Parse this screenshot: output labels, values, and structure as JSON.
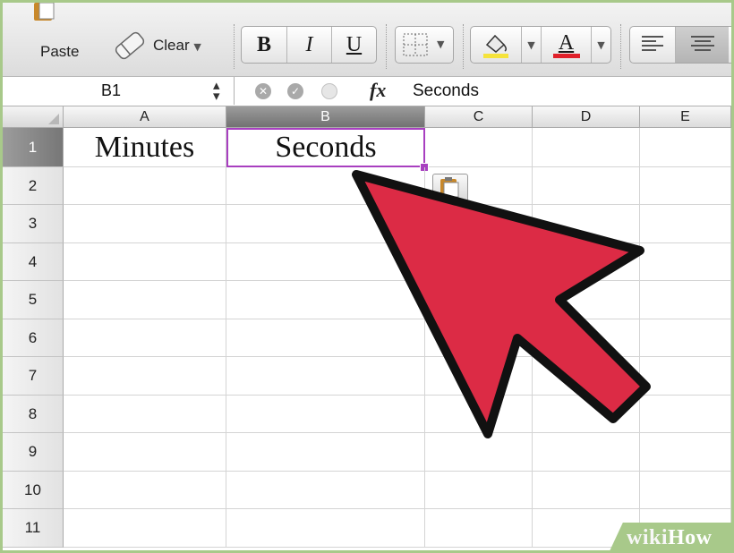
{
  "ribbon": {
    "paste_label": "Paste",
    "clear_label": "Clear",
    "bold_label": "B",
    "italic_label": "I",
    "underline_label": "U",
    "font_color_label": "A",
    "fill_color": "#f5e33b",
    "font_color": "#e0202a",
    "icons": [
      "paste-icon",
      "eraser-icon",
      "borders-icon",
      "fill-bucket-icon",
      "align-left-icon",
      "align-center-icon"
    ]
  },
  "formula_bar": {
    "cell_ref": "B1",
    "fx_label": "fx",
    "content": "Seconds"
  },
  "grid": {
    "columns": [
      "A",
      "B",
      "C",
      "D",
      "E"
    ],
    "selected_column": "B",
    "rows": [
      "1",
      "2",
      "3",
      "4",
      "5",
      "6",
      "7",
      "8",
      "9",
      "10",
      "11"
    ],
    "selected_row": "1",
    "cells": {
      "A1": "Minutes",
      "B1": "Seconds"
    },
    "selection_color": "#a83fc0"
  },
  "overlay": {
    "arrow_color": "#dc2b45",
    "watermark_wiki": "wiki",
    "watermark_how": "How"
  }
}
